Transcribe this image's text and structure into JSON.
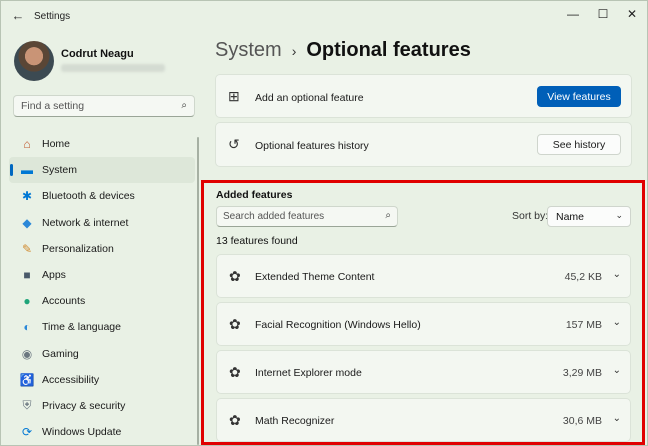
{
  "window": {
    "title": "Settings",
    "back_icon": "back-arrow-icon",
    "minimize": "—",
    "maximize": "☐",
    "close": "✕"
  },
  "user": {
    "name": "Codrut Neagu"
  },
  "search": {
    "placeholder": "Find a setting",
    "icon": "search-icon"
  },
  "sidebar": {
    "items": [
      {
        "label": "Home",
        "icon": "home-icon",
        "glyph": "⌂",
        "color": "#c0562d",
        "active": false
      },
      {
        "label": "System",
        "icon": "monitor-icon",
        "glyph": "▬",
        "color": "#0078d4",
        "active": true
      },
      {
        "label": "Bluetooth & devices",
        "icon": "bluetooth-icon",
        "glyph": "✱",
        "color": "#0078d4",
        "active": false
      },
      {
        "label": "Network & internet",
        "icon": "wifi-icon",
        "glyph": "◆",
        "color": "#2b88d8",
        "active": false
      },
      {
        "label": "Personalization",
        "icon": "brush-icon",
        "glyph": "✎",
        "color": "#d08a2e",
        "active": false
      },
      {
        "label": "Apps",
        "icon": "apps-icon",
        "glyph": "■",
        "color": "#4a5a6a",
        "active": false
      },
      {
        "label": "Accounts",
        "icon": "person-icon",
        "glyph": "●",
        "color": "#1fa57a",
        "active": false
      },
      {
        "label": "Time & language",
        "icon": "globe-icon",
        "glyph": "◐",
        "color": "#2b88d8",
        "active": false
      },
      {
        "label": "Gaming",
        "icon": "gamepad-icon",
        "glyph": "◉",
        "color": "#6b7780",
        "active": false
      },
      {
        "label": "Accessibility",
        "icon": "accessibility-icon",
        "glyph": "♿",
        "color": "#1469c7",
        "active": false
      },
      {
        "label": "Privacy & security",
        "icon": "shield-icon",
        "glyph": "⛨",
        "color": "#6b7780",
        "active": false
      },
      {
        "label": "Windows Update",
        "icon": "update-icon",
        "glyph": "⟳",
        "color": "#0078d4",
        "active": false
      }
    ]
  },
  "breadcrumb": {
    "parent": "System",
    "separator": "›",
    "current": "Optional features"
  },
  "cards": {
    "add": {
      "label": "Add an optional feature",
      "button": "View features",
      "icon": "add-feature-icon"
    },
    "history": {
      "label": "Optional features history",
      "button": "See history",
      "icon": "history-icon"
    }
  },
  "added": {
    "title": "Added features",
    "search_placeholder": "Search added features",
    "sort_label": "Sort by:",
    "sort_value": "Name",
    "count": "13 features found",
    "features": [
      {
        "name": "Extended Theme Content",
        "size": "45,2 KB"
      },
      {
        "name": "Facial Recognition (Windows Hello)",
        "size": "157 MB"
      },
      {
        "name": "Internet Explorer mode",
        "size": "3,29 MB"
      },
      {
        "name": "Math Recognizer",
        "size": "30,6 MB"
      }
    ]
  },
  "colors": {
    "accent": "#005fb8",
    "highlight": "#e00000"
  }
}
